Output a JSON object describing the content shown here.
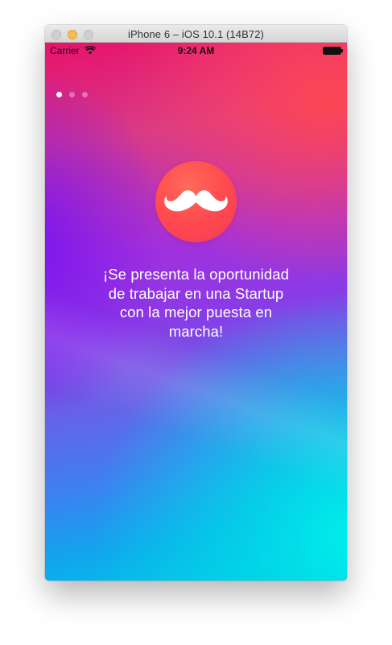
{
  "window": {
    "title": "iPhone 6 – iOS 10.1 (14B72)"
  },
  "status_bar": {
    "carrier": "Carrier",
    "time": "9:24 AM",
    "wifi_icon": "wifi-icon",
    "battery_icon": "battery-full-icon"
  },
  "onboarding": {
    "page_count": 3,
    "current_page": 1,
    "logo_icon": "mustache-icon",
    "headline": "¡Se presenta la oportunidad de trabajar en una Startup con la mejor puesta en marcha!"
  },
  "colors": {
    "gradient_top": "#e8126a",
    "gradient_mid": "#9a36e4",
    "gradient_bottom": "#00e6e8",
    "logo": "#ff4a4f",
    "text": "#ffffff"
  }
}
